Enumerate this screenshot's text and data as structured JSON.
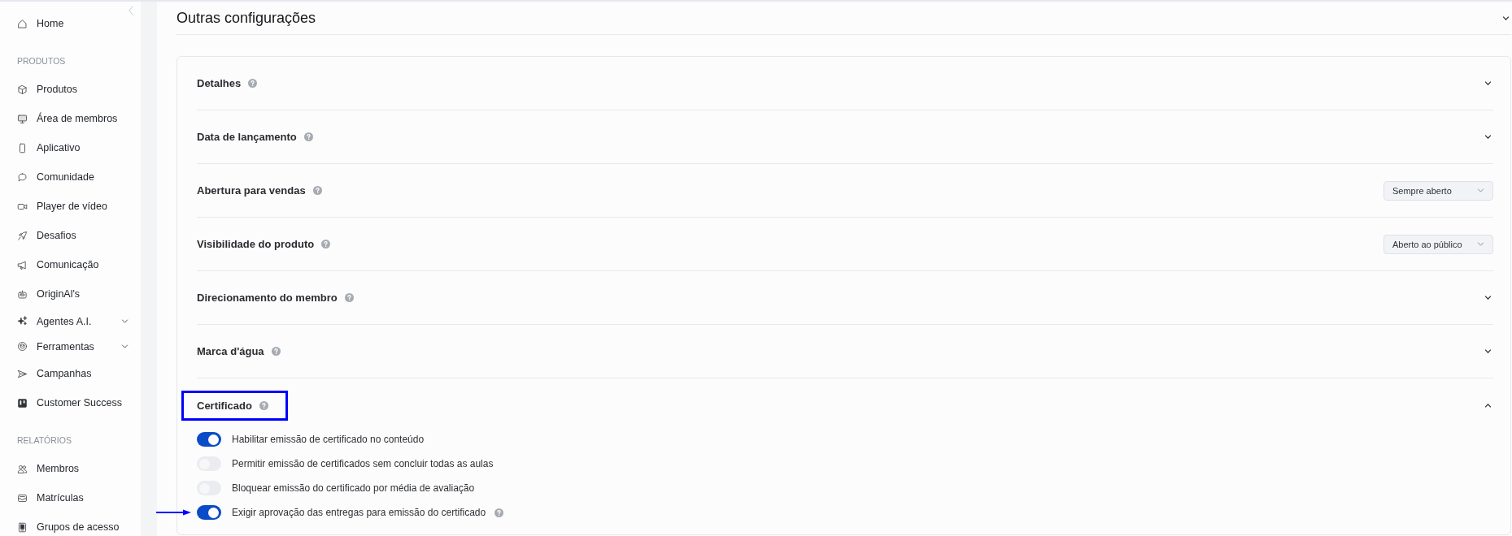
{
  "sidebar": {
    "sections": [
      {
        "items": [
          {
            "label": "Home",
            "kind": "link"
          }
        ]
      },
      {
        "heading": "PRODUTOS",
        "items": [
          {
            "label": "Produtos",
            "kind": "link"
          },
          {
            "label": "Área de membros",
            "kind": "link"
          },
          {
            "label": "Aplicativo",
            "kind": "link"
          },
          {
            "label": "Comunidade",
            "kind": "link"
          },
          {
            "label": "Player de vídeo",
            "kind": "link"
          },
          {
            "label": "Desafios",
            "kind": "link"
          },
          {
            "label": "Comunicação",
            "kind": "link"
          },
          {
            "label": "OriginAl's",
            "kind": "link"
          },
          {
            "label": "Agentes A.I.",
            "kind": "group",
            "expanded": false
          },
          {
            "label": "Ferramentas",
            "kind": "group",
            "expanded": false
          },
          {
            "label": "Campanhas",
            "kind": "link"
          },
          {
            "label": "Customer Success",
            "kind": "link"
          }
        ]
      },
      {
        "heading": "RELATÓRIOS",
        "items": [
          {
            "label": "Membros",
            "kind": "link"
          },
          {
            "label": "Matrículas",
            "kind": "link"
          },
          {
            "label": "Grupos de acesso",
            "kind": "link"
          }
        ]
      }
    ]
  },
  "settings": {
    "title": "Outras configurações",
    "sections": [
      {
        "title": "Detalhes",
        "kind": "collapsible",
        "expanded": false,
        "highlighted": false
      },
      {
        "title": "Data de lançamento",
        "kind": "collapsible",
        "expanded": false,
        "highlighted": false
      },
      {
        "title": "Abertura para vendas",
        "kind": "select",
        "value": "Sempre aberto",
        "highlighted": false
      },
      {
        "title": "Visibilidade do produto",
        "kind": "select",
        "value": "Aberto ao público",
        "highlighted": false
      },
      {
        "title": "Direcionamento do membro",
        "kind": "collapsible",
        "expanded": false,
        "highlighted": false
      },
      {
        "title": "Marca d'água",
        "kind": "collapsible",
        "expanded": false,
        "highlighted": false
      },
      {
        "title": "Certificado",
        "kind": "collapsible",
        "expanded": true,
        "highlighted": true,
        "options": [
          {
            "label": "Habilitar emissão de certificado no conteúdo",
            "on": true,
            "help": false,
            "pointed": false
          },
          {
            "label": "Permitir emissão de certificados sem concluir todas as aulas",
            "on": false,
            "help": false,
            "pointed": false
          },
          {
            "label": "Bloquear emissão do certificado por média de avaliação",
            "on": false,
            "help": false,
            "pointed": false
          },
          {
            "label": "Exigir aprovação das entregas para emissão do certificado",
            "on": true,
            "help": true,
            "pointed": true
          }
        ]
      }
    ]
  }
}
